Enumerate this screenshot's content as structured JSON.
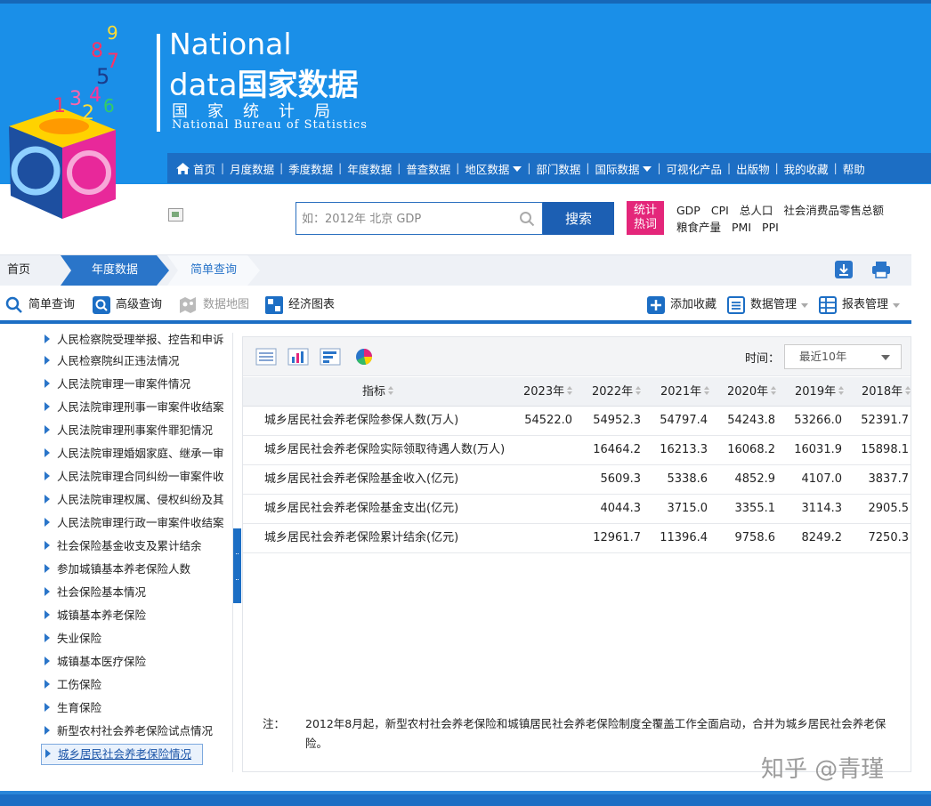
{
  "logo": {
    "line1": "National",
    "line2_latin": "data",
    "line2_cn": "国家数据",
    "org_cn": "国家统计局",
    "org_en": "National Bureau of Statistics"
  },
  "nav": {
    "items": [
      "首页",
      "月度数据",
      "季度数据",
      "年度数据",
      "普查数据",
      "地区数据",
      "部门数据",
      "国际数据",
      "可视化产品",
      "出版物",
      "我的收藏",
      "帮助"
    ]
  },
  "search": {
    "placeholder": "如：2012年 北京 GDP",
    "button": "搜索"
  },
  "hot": {
    "badge_l1": "统计",
    "badge_l2": "热词",
    "row1": [
      "GDP",
      "CPI",
      "总人口",
      "社会消费品零售总额"
    ],
    "row2": [
      "粮食产量",
      "PMI",
      "PPI"
    ]
  },
  "breadcrumb": {
    "home": "首页",
    "year": "年度数据",
    "query": "简单查询"
  },
  "toolbar": {
    "simple": "简单查询",
    "advanced": "高级查询",
    "map": "数据地图",
    "chart": "经济图表",
    "favorite": "添加收藏",
    "data_mgmt": "数据管理",
    "report_mgmt": "报表管理"
  },
  "sidebar": {
    "items": [
      "人民检察院受理举报、控告和申诉",
      "人民检察院纠正违法情况",
      "人民法院审理一审案件情况",
      "人民法院审理刑事一审案件收结案",
      "人民法院审理刑事案件罪犯情况",
      "人民法院审理婚姻家庭、继承一审",
      "人民法院审理合同纠纷一审案件收",
      "人民法院审理权属、侵权纠纷及其",
      "人民法院审理行政一审案件收结案",
      "社会保险基金收支及累计结余",
      "参加城镇基本养老保险人数",
      "社会保险基本情况",
      "城镇基本养老保险",
      "失业保险",
      "城镇基本医疗保险",
      "工伤保险",
      "生育保险",
      "新型农村社会养老保险试点情况",
      "城乡居民社会养老保险情况"
    ]
  },
  "filter": {
    "time_label": "时间：",
    "time_value": "最近10年"
  },
  "table": {
    "header_indicator": "指标",
    "years": [
      "2023年",
      "2022年",
      "2021年",
      "2020年",
      "2019年",
      "2018年"
    ],
    "rows": [
      {
        "name": "城乡居民社会养老保险参保人数(万人)",
        "values": [
          "54522.0",
          "54952.3",
          "54797.4",
          "54243.8",
          "53266.0",
          "52391.7"
        ]
      },
      {
        "name": "城乡居民社会养老保险实际领取待遇人数(万人)",
        "values": [
          "",
          "16464.2",
          "16213.3",
          "16068.2",
          "16031.9",
          "15898.1"
        ]
      },
      {
        "name": "城乡居民社会养老保险基金收入(亿元)",
        "values": [
          "",
          "5609.3",
          "5338.6",
          "4852.9",
          "4107.0",
          "3837.7"
        ]
      },
      {
        "name": "城乡居民社会养老保险基金支出(亿元)",
        "values": [
          "",
          "4044.3",
          "3715.0",
          "3355.1",
          "3114.3",
          "2905.5"
        ]
      },
      {
        "name": "城乡居民社会养老保险累计结余(亿元)",
        "values": [
          "",
          "12961.7",
          "11396.4",
          "9758.6",
          "8249.2",
          "7250.3"
        ]
      }
    ]
  },
  "note": {
    "label": "注：",
    "text": "2012年8月起，新型农村社会养老保险和城镇居民社会养老保险制度全覆盖工作全面启动，合并为城乡居民社会养老保险。"
  },
  "watermark": "知乎 @青瑾",
  "colors": {
    "header_blue": "#1a8fe8",
    "nav_blue": "#1c6ec4",
    "accent_pink": "#e4267a"
  }
}
